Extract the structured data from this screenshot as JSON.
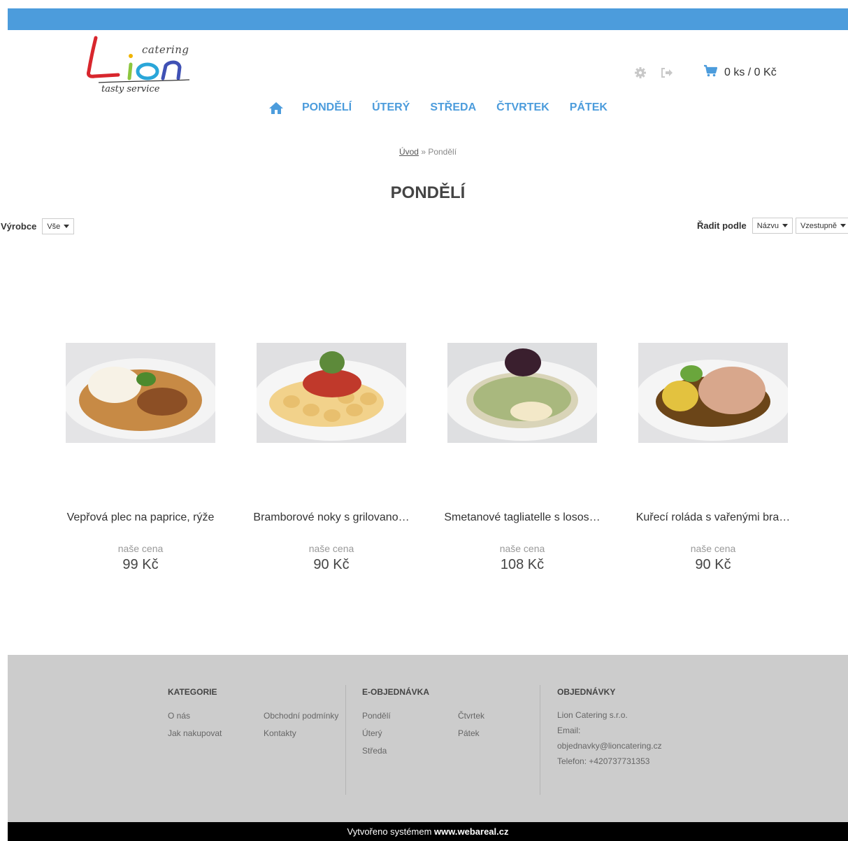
{
  "brand": {
    "catering_text": "catering",
    "tagline": "tasty service"
  },
  "header": {
    "cart_text": "0 ks / 0 Kč",
    "icons": [
      "gear-icon",
      "logout-icon",
      "cart-icon"
    ]
  },
  "nav": {
    "items": [
      {
        "label": "PONDĚLÍ"
      },
      {
        "label": "ÚTERÝ"
      },
      {
        "label": "STŘEDA"
      },
      {
        "label": "ČTVRTEK"
      },
      {
        "label": "PÁTEK"
      }
    ]
  },
  "breadcrumb": {
    "home": "Úvod",
    "separator": " » ",
    "current": "Pondělí"
  },
  "page_title": "PONDĚLÍ",
  "filters": {
    "manufacturer_label": "Výrobce",
    "manufacturer_value": "Vše",
    "sort_label": "Řadit podle",
    "sort_by_value": "Názvu",
    "sort_order_value": "Vzestupně"
  },
  "products": [
    {
      "name": "Vepřová plec na paprice, rýže",
      "price_label": "naše cena",
      "price": "99 Kč"
    },
    {
      "name": "Bramborové noky s grilovano…",
      "price_label": "naše cena",
      "price": "90 Kč"
    },
    {
      "name": "Smetanové tagliatelle s losos…",
      "price_label": "naše cena",
      "price": "108 Kč"
    },
    {
      "name": "Kuřecí roláda s vařenými bra…",
      "price_label": "naše cena",
      "price": "90 Kč"
    }
  ],
  "footer": {
    "kategorie": {
      "title": "KATEGORIE",
      "links_col1": [
        "O nás",
        "Jak nakupovat"
      ],
      "links_col2": [
        "Obchodní podmínky",
        "Kontakty"
      ]
    },
    "eobjednavka": {
      "title": "E-OBJEDNÁVKA",
      "links_col1": [
        "Pondělí",
        "Úterý",
        "Středa"
      ],
      "links_col2": [
        "Čtvrtek",
        "Pátek"
      ]
    },
    "objednavky": {
      "title": "OBJEDNÁVKY",
      "company": "Lion Catering s.r.o.",
      "email_label": "Email:",
      "email": "objednavky@lioncatering.cz",
      "phone": "Telefon: +420737731353"
    }
  },
  "bottom_bar": {
    "prefix": "Vytvořeno systémem ",
    "link": "www.webareal.cz"
  },
  "colors": {
    "accent": "#4c9cdc",
    "footer_bg": "#cccccc",
    "bottom_bg": "#000000"
  }
}
